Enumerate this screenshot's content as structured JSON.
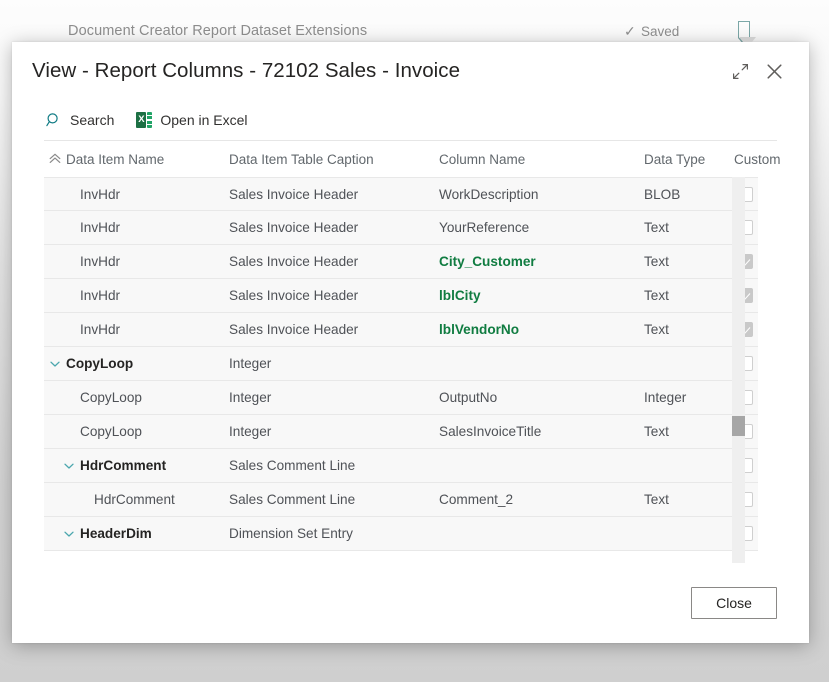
{
  "background": {
    "breadcrumb": "Document Creator Report Dataset Extensions",
    "saved_label": "Saved",
    "saved_icon": "check-icon",
    "bookmark_icon": "bookmark-icon"
  },
  "dialog": {
    "title": "View - Report Columns - 72102 Sales - Invoice",
    "expand_icon": "expand-diagonal-icon",
    "close_icon": "close-x-icon",
    "commands": [
      {
        "label": "Search",
        "icon": "search-icon"
      },
      {
        "label": "Open in Excel",
        "icon": "excel-icon"
      }
    ],
    "footer": {
      "close_label": "Close"
    }
  },
  "grid": {
    "sort_icon": "chevron-up-icon",
    "sort_column": "Data Item Name",
    "columns": [
      {
        "key": "data_item_name",
        "label": "Data Item Name"
      },
      {
        "key": "data_item_table_caption",
        "label": "Data Item Table Caption"
      },
      {
        "key": "column_name",
        "label": "Column Name"
      },
      {
        "key": "data_type",
        "label": "Data Type"
      },
      {
        "key": "custom",
        "label": "Custom"
      }
    ],
    "rows": [
      {
        "data_item_name": "InvHdr",
        "data_item_table_caption": "Sales Invoice Header",
        "column_name": "WorkDescription",
        "data_type": "BLOB",
        "custom": false,
        "indent": 1,
        "group": false,
        "expanded": null,
        "highlight": false
      },
      {
        "data_item_name": "InvHdr",
        "data_item_table_caption": "Sales Invoice Header",
        "column_name": "YourReference",
        "data_type": "Text",
        "custom": false,
        "indent": 1,
        "group": false,
        "expanded": null,
        "highlight": false
      },
      {
        "data_item_name": "InvHdr",
        "data_item_table_caption": "Sales Invoice Header",
        "column_name": "City_Customer",
        "data_type": "Text",
        "custom": true,
        "indent": 1,
        "group": false,
        "expanded": null,
        "highlight": true
      },
      {
        "data_item_name": "InvHdr",
        "data_item_table_caption": "Sales Invoice Header",
        "column_name": "lblCity",
        "data_type": "Text",
        "custom": true,
        "indent": 1,
        "group": false,
        "expanded": null,
        "highlight": true
      },
      {
        "data_item_name": "InvHdr",
        "data_item_table_caption": "Sales Invoice Header",
        "column_name": "lblVendorNo",
        "data_type": "Text",
        "custom": true,
        "indent": 1,
        "group": false,
        "expanded": null,
        "highlight": true
      },
      {
        "data_item_name": "CopyLoop",
        "data_item_table_caption": "Integer",
        "column_name": "",
        "data_type": "",
        "custom": false,
        "indent": 0,
        "group": true,
        "expanded": true,
        "highlight": false
      },
      {
        "data_item_name": "CopyLoop",
        "data_item_table_caption": "Integer",
        "column_name": "OutputNo",
        "data_type": "Integer",
        "custom": false,
        "indent": 1,
        "group": false,
        "expanded": null,
        "highlight": false
      },
      {
        "data_item_name": "CopyLoop",
        "data_item_table_caption": "Integer",
        "column_name": "SalesInvoiceTitle",
        "data_type": "Text",
        "custom": false,
        "indent": 1,
        "group": false,
        "expanded": null,
        "highlight": false
      },
      {
        "data_item_name": "HdrComment",
        "data_item_table_caption": "Sales Comment Line",
        "column_name": "",
        "data_type": "",
        "custom": false,
        "indent": 1,
        "group": true,
        "expanded": true,
        "highlight": false
      },
      {
        "data_item_name": "HdrComment",
        "data_item_table_caption": "Sales Comment Line",
        "column_name": "Comment_2",
        "data_type": "Text",
        "custom": false,
        "indent": 2,
        "group": false,
        "expanded": null,
        "highlight": false
      },
      {
        "data_item_name": "HeaderDim",
        "data_item_table_caption": "Dimension Set Entry",
        "column_name": "",
        "data_type": "",
        "custom": false,
        "indent": 1,
        "group": true,
        "expanded": true,
        "highlight": false
      }
    ],
    "scroll": {
      "thumb_top_pct": 62,
      "thumb_height_pct": 5
    }
  }
}
